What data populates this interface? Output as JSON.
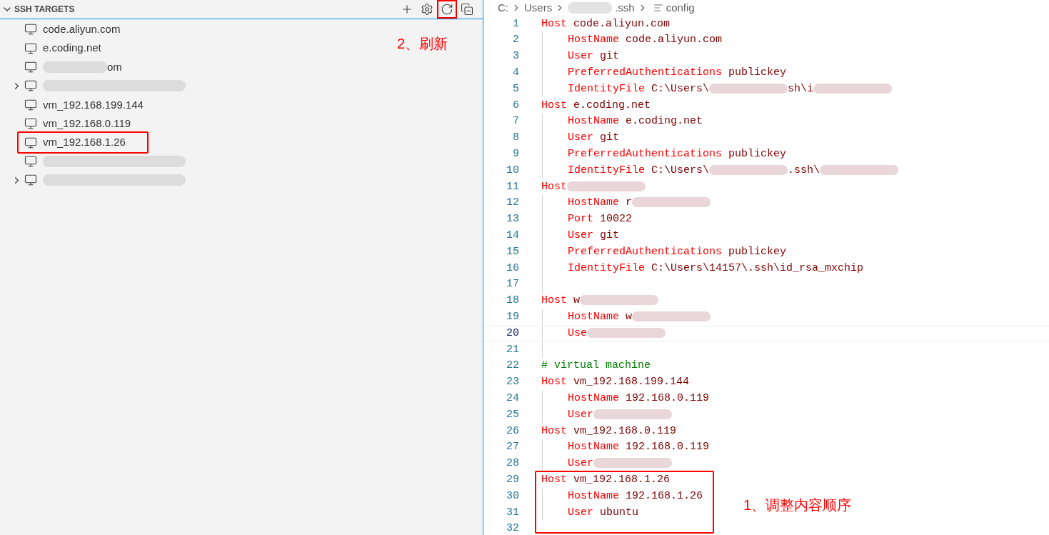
{
  "sidebar": {
    "title": "SSH TARGETS",
    "expanded": true,
    "actions": [
      {
        "kind": "add",
        "boxed": false
      },
      {
        "kind": "settings",
        "boxed": false
      },
      {
        "kind": "refresh",
        "boxed": true
      },
      {
        "kind": "collapse",
        "boxed": false
      }
    ],
    "items": [
      {
        "label": "code.aliyun.com",
        "expandable": false,
        "boxed": false
      },
      {
        "label": "e.coding.net",
        "expandable": false,
        "boxed": false
      },
      {
        "label": "om",
        "redacted": true,
        "expandable": false,
        "boxed": false
      },
      {
        "redacted": true,
        "expandable": true,
        "boxed": false
      },
      {
        "label": "vm_192.168.199.144",
        "expandable": false,
        "boxed": false
      },
      {
        "label": "vm_192.168.0.119",
        "expandable": false,
        "boxed": false
      },
      {
        "label": "vm_192.168.1.26",
        "expandable": false,
        "boxed": true
      },
      {
        "redacted": true,
        "expandable": false,
        "boxed": false
      },
      {
        "redacted": true,
        "expandable": true,
        "boxed": false
      }
    ],
    "annotation": {
      "text": "2、刷新"
    }
  },
  "breadcrumb": {
    "parts": [
      {
        "kind": "text",
        "text": "C:"
      },
      {
        "kind": "text",
        "text": "Users"
      },
      {
        "kind": "blur",
        "text": ".ssh"
      },
      {
        "kind": "file",
        "text": "config"
      }
    ]
  },
  "editor": {
    "lines": [
      {
        "n": "1",
        "current": false,
        "boxed": false,
        "segs": [
          {
            "kind": "key",
            "text": "Host"
          },
          {
            "kind": "value",
            "text": " code.aliyun.com"
          }
        ],
        "children": [
          {
            "n": "2",
            "current": false,
            "segs": [
              {
                "kind": "key",
                "text": "HostName"
              },
              {
                "kind": "value",
                "text": " code.aliyun.com"
              }
            ]
          },
          {
            "n": "3",
            "current": false,
            "segs": [
              {
                "kind": "key",
                "text": "User"
              },
              {
                "kind": "value",
                "text": " git"
              }
            ]
          },
          {
            "n": "4",
            "current": false,
            "segs": [
              {
                "kind": "key",
                "text": "PreferredAuthentications"
              },
              {
                "kind": "value",
                "text": " publickey"
              }
            ]
          },
          {
            "n": "5",
            "current": false,
            "segs": [
              {
                "kind": "key",
                "text": "IdentityFile"
              },
              {
                "kind": "value",
                "text": " C:\\Users\\"
              },
              {
                "kind": "blur"
              },
              {
                "kind": "value",
                "text": "sh\\i"
              },
              {
                "kind": "blur"
              }
            ]
          }
        ]
      },
      {
        "n": "6",
        "current": false,
        "boxed": false,
        "segs": [
          {
            "kind": "key",
            "text": "Host"
          },
          {
            "kind": "value",
            "text": " e.coding.net"
          }
        ],
        "children": [
          {
            "n": "7",
            "current": false,
            "segs": [
              {
                "kind": "key",
                "text": "HostName"
              },
              {
                "kind": "value",
                "text": " e.coding.net"
              }
            ]
          },
          {
            "n": "8",
            "current": false,
            "segs": [
              {
                "kind": "key",
                "text": "User"
              },
              {
                "kind": "value",
                "text": " git"
              }
            ]
          },
          {
            "n": "9",
            "current": false,
            "segs": [
              {
                "kind": "key",
                "text": "PreferredAuthentications"
              },
              {
                "kind": "value",
                "text": " publickey"
              }
            ]
          },
          {
            "n": "10",
            "current": false,
            "segs": [
              {
                "kind": "key",
                "text": "IdentityFile"
              },
              {
                "kind": "value",
                "text": " C:\\Users\\"
              },
              {
                "kind": "blur"
              },
              {
                "kind": "value",
                "text": ".ssh\\"
              },
              {
                "kind": "blur"
              }
            ]
          }
        ]
      },
      {
        "n": "11",
        "current": false,
        "boxed": false,
        "segs": [
          {
            "kind": "key",
            "text": "Host"
          },
          {
            "kind": "blur"
          }
        ],
        "children": [
          {
            "n": "12",
            "current": false,
            "segs": [
              {
                "kind": "key",
                "text": "HostName"
              },
              {
                "kind": "value",
                "text": " r"
              },
              {
                "kind": "blur"
              }
            ]
          },
          {
            "n": "13",
            "current": false,
            "segs": [
              {
                "kind": "key",
                "text": "Port"
              },
              {
                "kind": "value",
                "text": " 10022"
              }
            ]
          },
          {
            "n": "14",
            "current": false,
            "segs": [
              {
                "kind": "key",
                "text": "User"
              },
              {
                "kind": "value",
                "text": " git"
              }
            ]
          },
          {
            "n": "15",
            "current": false,
            "segs": [
              {
                "kind": "key",
                "text": "PreferredAuthentications"
              },
              {
                "kind": "value",
                "text": " publickey"
              }
            ]
          },
          {
            "n": "16",
            "current": false,
            "segs": [
              {
                "kind": "key",
                "text": "IdentityFile"
              },
              {
                "kind": "value",
                "text": " C:\\Users\\14157\\.ssh\\id_rsa_mxchip"
              }
            ]
          },
          {
            "n": "17",
            "current": false
          }
        ]
      },
      {
        "n": "18",
        "current": false,
        "boxed": false,
        "segs": [
          {
            "kind": "key",
            "text": "Host"
          },
          {
            "kind": "value",
            "text": " w"
          },
          {
            "kind": "blur"
          }
        ],
        "children": [
          {
            "n": "19",
            "current": false,
            "segs": [
              {
                "kind": "key",
                "text": "HostName"
              },
              {
                "kind": "value",
                "text": " w"
              },
              {
                "kind": "blur"
              }
            ]
          },
          {
            "n": "20",
            "current": true,
            "segs": [
              {
                "kind": "key",
                "text": "Use"
              },
              {
                "kind": "blur"
              }
            ]
          },
          {
            "n": "21",
            "current": false
          }
        ]
      },
      {
        "n": "22",
        "current": false,
        "boxed": false,
        "segs": [
          {
            "kind": "comment",
            "text": "# virtual machine"
          }
        ]
      },
      {
        "n": "23",
        "current": false,
        "boxed": false,
        "segs": [
          {
            "kind": "key",
            "text": "Host"
          },
          {
            "kind": "value",
            "text": " vm_192.168.199.144"
          }
        ],
        "children": [
          {
            "n": "24",
            "current": false,
            "segs": [
              {
                "kind": "key",
                "text": "HostName"
              },
              {
                "kind": "value",
                "text": " 192.168.0.119"
              }
            ]
          },
          {
            "n": "25",
            "current": false,
            "segs": [
              {
                "kind": "key",
                "text": "User"
              },
              {
                "kind": "blur"
              }
            ]
          }
        ]
      },
      {
        "n": "26",
        "current": false,
        "boxed": false,
        "segs": [
          {
            "kind": "key",
            "text": "Host"
          },
          {
            "kind": "value",
            "text": " vm_192.168.0.119"
          }
        ],
        "children": [
          {
            "n": "27",
            "current": false,
            "segs": [
              {
                "kind": "key",
                "text": "HostName"
              },
              {
                "kind": "value",
                "text": " 192.168.0.119"
              }
            ]
          },
          {
            "n": "28",
            "current": false,
            "segs": [
              {
                "kind": "key",
                "text": "User"
              },
              {
                "kind": "blur"
              }
            ]
          }
        ]
      },
      {
        "n": "29",
        "current": false,
        "boxed": true,
        "segs": [
          {
            "kind": "key",
            "text": "Host"
          },
          {
            "kind": "value",
            "text": " vm_192.168.1.26"
          }
        ],
        "children": [
          {
            "n": "30",
            "current": false,
            "segs": [
              {
                "kind": "key",
                "text": "HostName"
              },
              {
                "kind": "value",
                "text": " 192.168.1.26"
              }
            ]
          },
          {
            "n": "31",
            "current": false,
            "segs": [
              {
                "kind": "key",
                "text": "User"
              },
              {
                "kind": "value",
                "text": " ubuntu"
              }
            ]
          }
        ]
      },
      {
        "n": "32",
        "current": false,
        "boxed": false
      }
    ],
    "annotation": {
      "text": "1、调整内容顺序"
    }
  }
}
